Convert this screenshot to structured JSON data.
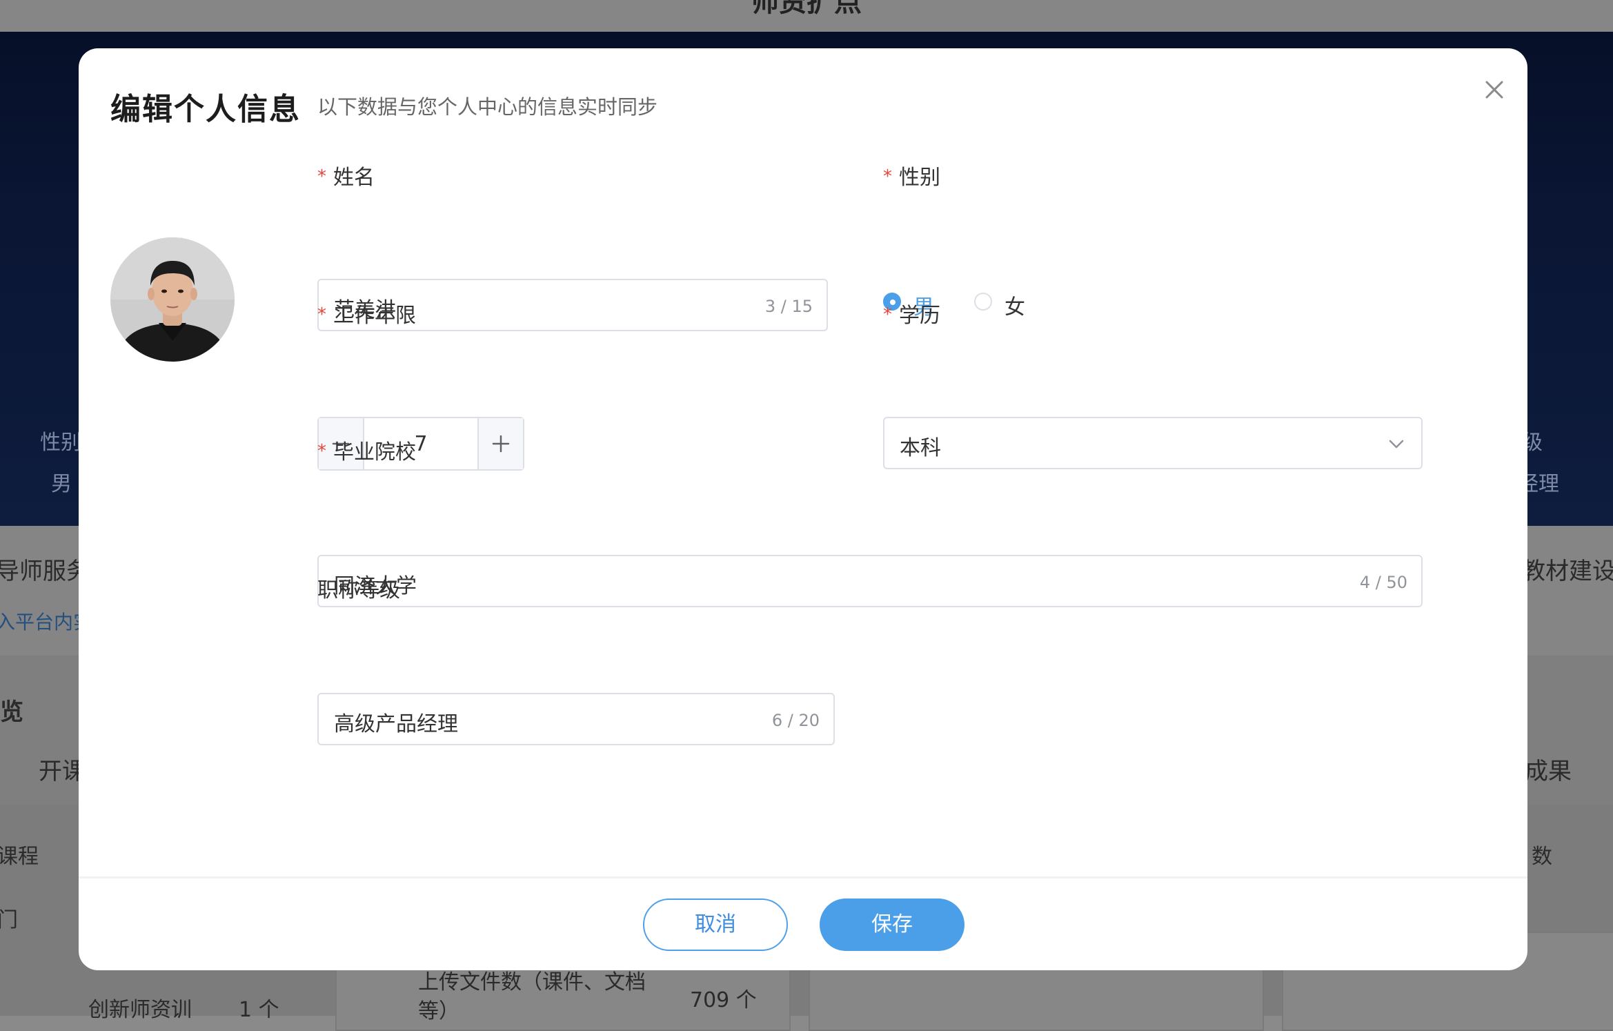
{
  "background": {
    "header_title": "师资扩点",
    "left_stat_label": "性别",
    "left_stat_value": "男",
    "right_stat_label": "级",
    "right_stat_value": "经理",
    "section_left_title": "导师服务",
    "section_left_link": "入平台内实",
    "section_right_title": "教材建设",
    "overview_title": "览",
    "tab_left": "开课",
    "tab_right": "成果",
    "row_course": "课程",
    "row_door": "门",
    "row_right": "数",
    "card_left_label": "创新师资训",
    "card_left_value": "1 个",
    "card_mid_label_1": "上传文件数（课件、文档",
    "card_mid_label_2": "等）",
    "card_mid_value": "709 个"
  },
  "modal": {
    "title": "编辑个人信息",
    "subtitle": "以下数据与您个人中心的信息实时同步",
    "close_icon": "close-icon",
    "avatar_alt": "avatar"
  },
  "form": {
    "required_mark": "*",
    "name": {
      "label": "姓名",
      "value": "范美洪",
      "counter": "3 / 15"
    },
    "gender": {
      "label": "性别",
      "options": [
        "男",
        "女"
      ],
      "selected": "男"
    },
    "years": {
      "label": "工作年限",
      "value": "7",
      "minus": "−",
      "plus": "+"
    },
    "education": {
      "label": "学历",
      "value": "本科"
    },
    "school": {
      "label": "毕业院校",
      "value": "同济大学",
      "counter": "4 / 50"
    },
    "title_level": {
      "label": "职称等级",
      "value": "高级产品经理",
      "counter": "6 / 20"
    }
  },
  "footer": {
    "cancel_label": "取消",
    "save_label": "保存"
  },
  "colors": {
    "primary": "#4a9fe8",
    "required": "#e5463c"
  }
}
